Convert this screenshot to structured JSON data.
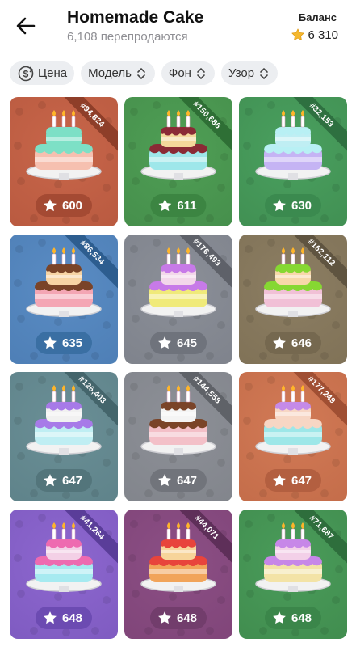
{
  "header": {
    "title": "Homemade Cake",
    "subtitle": "6,108 перепродаются",
    "balance_label": "Баланс",
    "balance_value": "6 310"
  },
  "filters": [
    {
      "label": "Цена",
      "icon": "price-sort-icon"
    },
    {
      "label": "Модель",
      "icon": "sort-arrows-icon"
    },
    {
      "label": "Фон",
      "icon": "sort-arrows-icon"
    },
    {
      "label": "Узор",
      "icon": "sort-arrows-icon"
    }
  ],
  "colors": {
    "star": "#f5b82e",
    "chip_bg": "#eceef1"
  },
  "items": [
    {
      "number": "#94,824",
      "price": "600",
      "bg": "#c8664a",
      "bg2": "#b95a40",
      "ribbon": "#8e3e29",
      "pill": "#a44a33",
      "layers": [
        "#f6c0b0",
        "#7de0c6"
      ],
      "icing": "#7de0c6",
      "top_icing": "#7de0c6"
    },
    {
      "number": "#150,686",
      "price": "611",
      "bg": "#4f9f55",
      "bg2": "#468f4c",
      "ribbon": "#2e6f35",
      "pill": "#3c8542",
      "layers": [
        "#9ee7ea",
        "#f3d79a"
      ],
      "icing": "#8a2a35",
      "top_icing": "#8a2a35"
    },
    {
      "number": "#32,153",
      "price": "630",
      "bg": "#4aa05f",
      "bg2": "#419053",
      "ribbon": "#2e7040",
      "pill": "#3b8a4f",
      "layers": [
        "#c5b4f4",
        "#bfeef3"
      ],
      "icing": "#b8f0f4",
      "top_icing": "#b8f0f4"
    },
    {
      "number": "#86,534",
      "price": "635",
      "bg": "#5a8cc4",
      "bg2": "#4e7fb6",
      "ribbon": "#2d5d8f",
      "pill": "#3a6fa3",
      "layers": [
        "#f4a6b4",
        "#f7d4a4"
      ],
      "icing": "#7a4428",
      "top_icing": "#7a4428"
    },
    {
      "number": "#176,493",
      "price": "645",
      "bg": "#8b8f98",
      "bg2": "#7f838c",
      "ribbon": "#5e6169",
      "pill": "#6f737c",
      "layers": [
        "#f0ea7a",
        "#f3d7ea"
      ],
      "icing": "#c77ae8",
      "top_icing": "#c77ae8"
    },
    {
      "number": "#162,112",
      "price": "646",
      "bg": "#8c7e63",
      "bg2": "#807257",
      "ribbon": "#5f5440",
      "pill": "#75684f",
      "layers": [
        "#f1c0d6",
        "#f7d8a9"
      ],
      "icing": "#86d832",
      "top_icing": "#86d832"
    },
    {
      "number": "#126,403",
      "price": "647",
      "bg": "#6a8f96",
      "bg2": "#5f838a",
      "ribbon": "#44656b",
      "pill": "#53757b",
      "layers": [
        "#bfeef3",
        "#f1f1f1"
      ],
      "icing": "#a77ae8",
      "top_icing": "#a77ae8"
    },
    {
      "number": "#144,558",
      "price": "647",
      "bg": "#8d9097",
      "bg2": "#82858c",
      "ribbon": "#5f6268",
      "pill": "#71747b",
      "layers": [
        "#f3c0c8",
        "#f4f4f4"
      ],
      "icing": "#7a4428",
      "top_icing": "#7a4428"
    },
    {
      "number": "#177,249",
      "price": "647",
      "bg": "#d27a56",
      "bg2": "#c46d4a",
      "ribbon": "#a04f33",
      "pill": "#b35f40",
      "layers": [
        "#9de7e8",
        "#f7d6c4"
      ],
      "icing": "#f7d6c4",
      "top_icing": "#c58ae8"
    },
    {
      "number": "#41,264",
      "price": "648",
      "bg": "#8d67cf",
      "bg2": "#7f5bc1",
      "ribbon": "#5a3d99",
      "pill": "#6c4bb2",
      "layers": [
        "#a6eaf0",
        "#f3d0e6"
      ],
      "icing": "#ee6ab0",
      "top_icing": "#ee6ab0"
    },
    {
      "number": "#44,071",
      "price": "648",
      "bg": "#8c4f85",
      "bg2": "#804579",
      "ribbon": "#5e2f59",
      "pill": "#723d6c",
      "layers": [
        "#f1a45a",
        "#f7d49a"
      ],
      "icing": "#e8443c",
      "top_icing": "#e8443c"
    },
    {
      "number": "#71,687",
      "price": "648",
      "bg": "#4a9c5a",
      "bg2": "#418d4f",
      "ribbon": "#2e6e3c",
      "pill": "#3b864a",
      "layers": [
        "#f3e3a6",
        "#f3d0e8"
      ],
      "icing": "#c787e8",
      "top_icing": "#c787e8"
    }
  ]
}
